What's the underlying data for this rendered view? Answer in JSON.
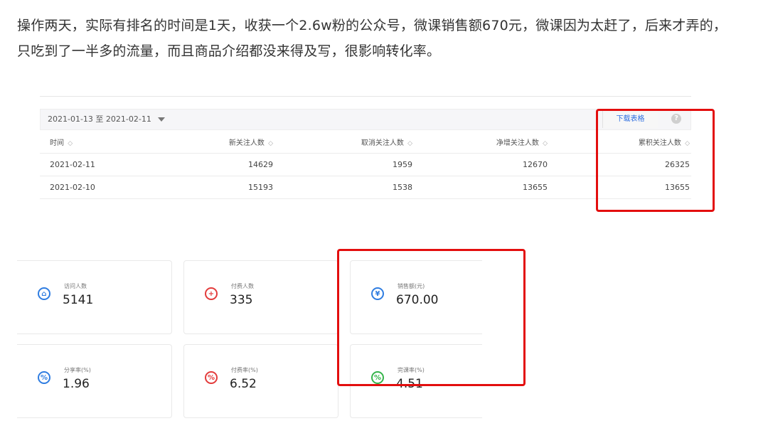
{
  "paragraph": "操作两天，实际有排名的时间是1天，收获一个2.6w粉的公众号，微课销售额670元，微课因为太赶了，后来才弄的，只吃到了一半多的流量，而且商品介绍都没来得及写，很影响转化率。",
  "table": {
    "date_range": "2021-01-13 至 2021-02-11",
    "download_label": "下载表格",
    "help_icon": "?",
    "sort_symbol": "◇",
    "headers": {
      "time": "时间",
      "new_followers": "新关注人数",
      "cancel_followers": "取消关注人数",
      "net_followers": "净增关注人数",
      "cumulative_followers": "累积关注人数"
    },
    "rows": [
      {
        "time": "2021-02-11",
        "new_followers": "14629",
        "cancel_followers": "1959",
        "net_followers": "12670",
        "cumulative_followers": "26325"
      },
      {
        "time": "2021-02-10",
        "new_followers": "15193",
        "cancel_followers": "1538",
        "net_followers": "13655",
        "cumulative_followers": "13655"
      }
    ]
  },
  "stats": {
    "visitors": {
      "label": "访问人数",
      "value": "5141",
      "icon": "user-icon",
      "color": "#2f7de1"
    },
    "paying_users": {
      "label": "付费人数",
      "value": "335",
      "icon": "user-plus-icon",
      "color": "#e33b3b"
    },
    "sales": {
      "label": "销售额(元)",
      "value": "670.00",
      "icon": "money-icon",
      "color": "#2f7de1"
    },
    "share_rate": {
      "label": "分享率(%)",
      "value": "1.96",
      "icon": "percent-icon",
      "color": "#2f7de1"
    },
    "pay_rate": {
      "label": "付费率(%)",
      "value": "6.52",
      "icon": "percent-icon",
      "color": "#e33b3b"
    },
    "completion_rate": {
      "label": "完课率(%)",
      "value": "4.51",
      "icon": "percent-icon",
      "color": "#35b44a"
    }
  },
  "annotation_color": "#e30e0e"
}
